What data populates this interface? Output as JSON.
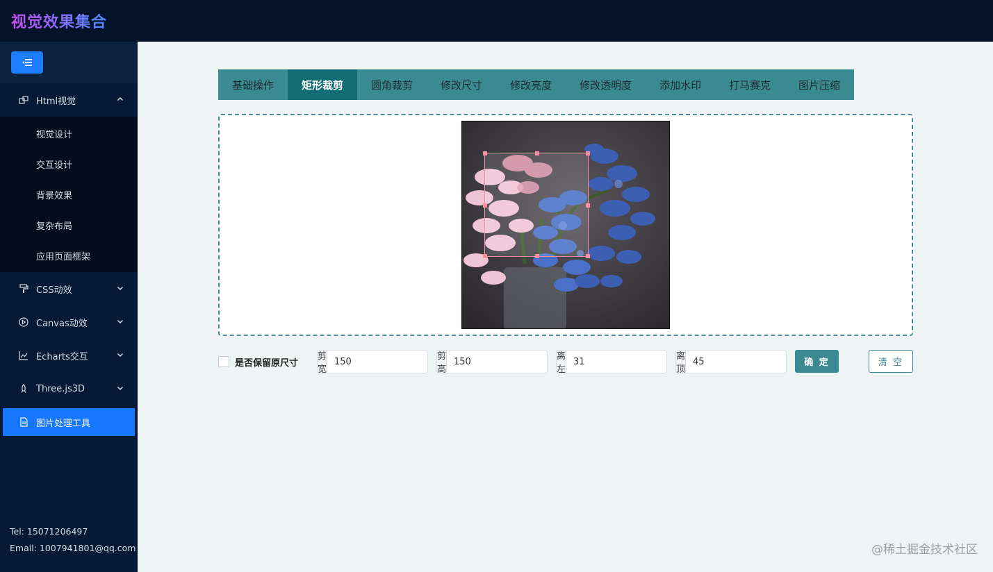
{
  "app": {
    "title": "视觉效果集合"
  },
  "sidebar": {
    "collapse_icon": "menu-fold-icon",
    "menus": [
      {
        "label": "Html视觉",
        "icon": "layers-icon",
        "expanded": true,
        "children": [
          "视觉设计",
          "交互设计",
          "背景效果",
          "复杂布局",
          "应用页面框架"
        ]
      },
      {
        "label": "CSS动效",
        "icon": "paint-roller-icon"
      },
      {
        "label": "Canvas动效",
        "icon": "play-circle-icon"
      },
      {
        "label": "Echarts交互",
        "icon": "line-chart-icon"
      },
      {
        "label": "Three.js3D",
        "icon": "rocket-icon"
      },
      {
        "label": "图片处理工具",
        "icon": "file-icon",
        "active": true
      }
    ],
    "contact": {
      "tel": "Tel: 15071206497",
      "email": "Email: 1007941801@qq.com"
    }
  },
  "tabs": [
    "基础操作",
    "矩形裁剪",
    "圆角裁剪",
    "修改尺寸",
    "修改亮度",
    "修改透明度",
    "添加水印",
    "打马赛克",
    "图片压缩"
  ],
  "active_tab": "矩形裁剪",
  "colors": {
    "accent": "#3a8b91",
    "active_tab": "#126c74",
    "sidebar": "#061a35",
    "primary": "#1677ff",
    "crop": "#ff8fa3"
  },
  "crop_form": {
    "keep_size_label": "是否保留原尺寸",
    "keep_size_checked": false,
    "width_label": "裁剪宽度",
    "width_value": "150",
    "height_label": "裁剪高度",
    "height_value": "150",
    "left_label": "距离左侧",
    "left_value": "31",
    "top_label": "距离顶部",
    "top_value": "45",
    "confirm_label": "确 定",
    "clear_label": "清 空"
  },
  "watermark": "@稀土掘金技术社区"
}
